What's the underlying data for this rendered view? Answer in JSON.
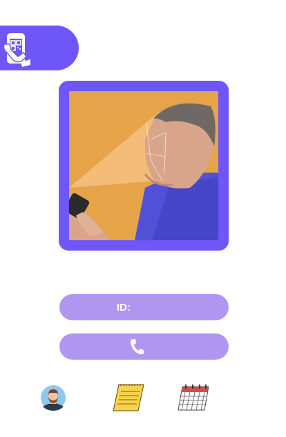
{
  "header": {
    "app_icon": "qr-phone-icon"
  },
  "photo": {
    "description_icon": "face-scan-photo"
  },
  "id_field": {
    "label": "ID:"
  },
  "phone_field": {
    "icon": "phone-icon"
  },
  "bottom_nav": {
    "items": [
      "avatar-icon",
      "notepad-icon",
      "calendar-icon"
    ]
  },
  "colors": {
    "accent": "#6e56f7",
    "pill": "#b096f1",
    "background": "#ffffff"
  }
}
